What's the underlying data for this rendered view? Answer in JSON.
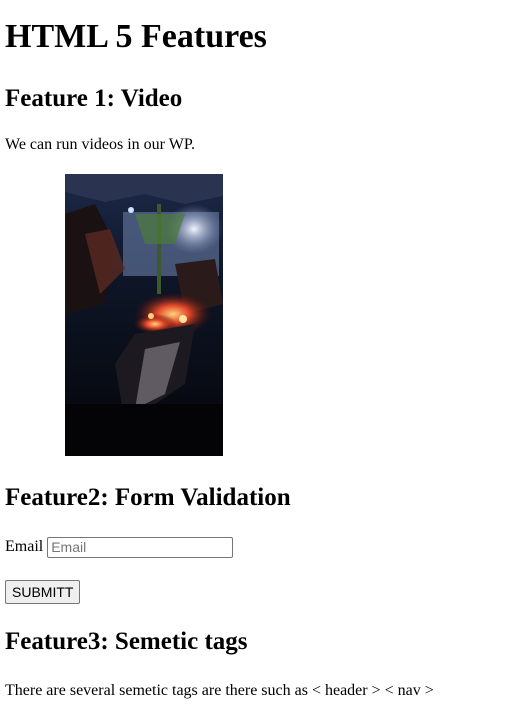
{
  "page": {
    "title": "HTML 5 Features"
  },
  "feature1": {
    "heading": "Feature 1: Video",
    "description": "We can run videos in our WP."
  },
  "feature2": {
    "heading": "Feature2: Form Validation",
    "email_label": "Email",
    "email_placeholder": "Email",
    "submit_label": "SUBMITT"
  },
  "feature3": {
    "heading": "Feature3: Semetic tags",
    "description": "There are several semetic tags are there such as < header > < nav >"
  }
}
